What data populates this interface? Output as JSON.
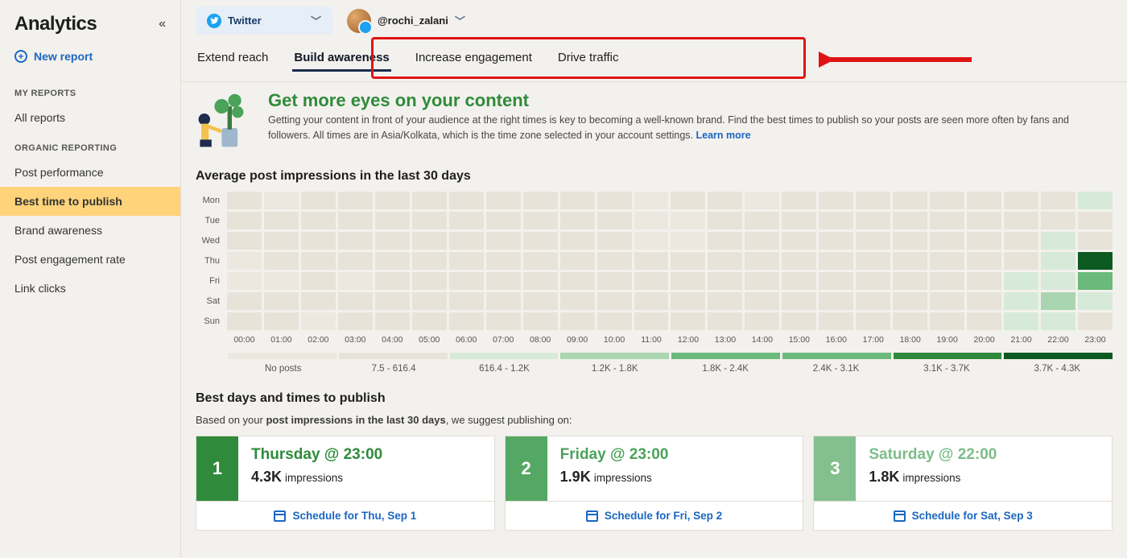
{
  "sidebar": {
    "title": "Analytics",
    "new_report": "New report",
    "sections": {
      "my_reports": {
        "label": "MY REPORTS",
        "items": [
          "All reports"
        ]
      },
      "organic": {
        "label": "ORGANIC REPORTING",
        "items": [
          "Post performance",
          "Best time to publish",
          "Brand awareness",
          "Post engagement rate",
          "Link clicks"
        ],
        "selected_index": 1
      }
    }
  },
  "header": {
    "platform": {
      "name": "Twitter"
    },
    "account": {
      "handle": "@rochi_zalani"
    }
  },
  "tabs": {
    "items": [
      "Extend reach",
      "Build awareness",
      "Increase engagement",
      "Drive traffic"
    ],
    "active_index": 1
  },
  "hero": {
    "title": "Get more eyes on your content",
    "desc": "Getting your content in front of your audience at the right times is key to becoming a well-known brand. Find the best times to publish so your posts are seen more often by fans and followers. All times are in Asia/Kolkata, which is the time zone selected in your account settings. ",
    "learn": "Learn more"
  },
  "heatmap": {
    "title": "Average post impressions in the last 30 days",
    "days": [
      "Mon",
      "Tue",
      "Wed",
      "Thu",
      "Fri",
      "Sat",
      "Sun"
    ],
    "hours": [
      "00:00",
      "01:00",
      "02:00",
      "03:00",
      "04:00",
      "05:00",
      "06:00",
      "07:00",
      "08:00",
      "09:00",
      "10:00",
      "11:00",
      "12:00",
      "13:00",
      "14:00",
      "15:00",
      "16:00",
      "17:00",
      "18:00",
      "19:00",
      "20:00",
      "21:00",
      "22:00",
      "23:00"
    ],
    "legend_segments": [
      {
        "label": "No posts",
        "intensity": 0
      },
      {
        "label": "7.5 - 616.4",
        "intensity": 1
      },
      {
        "label": "616.4 - 1.2K",
        "intensity": 2
      },
      {
        "label": "1.2K - 1.8K",
        "intensity": 3
      },
      {
        "label": "1.8K - 2.4K",
        "intensity": 4
      },
      {
        "label": "2.4K - 3.1K",
        "intensity": 4
      },
      {
        "label": "3.1K - 3.7K",
        "intensity": 5
      },
      {
        "label": "3.7K - 4.3K",
        "intensity": 6
      }
    ]
  },
  "chart_data": {
    "type": "heatmap",
    "title": "Average post impressions in the last 30 days",
    "xlabel": "Hour of day",
    "ylabel": "Day of week",
    "x": [
      "00:00",
      "01:00",
      "02:00",
      "03:00",
      "04:00",
      "05:00",
      "06:00",
      "07:00",
      "08:00",
      "09:00",
      "10:00",
      "11:00",
      "12:00",
      "13:00",
      "14:00",
      "15:00",
      "16:00",
      "17:00",
      "18:00",
      "19:00",
      "20:00",
      "21:00",
      "22:00",
      "23:00"
    ],
    "y": [
      "Mon",
      "Tue",
      "Wed",
      "Thu",
      "Fri",
      "Sat",
      "Sun"
    ],
    "values_intensity": [
      [
        1,
        0,
        1,
        1,
        1,
        1,
        1,
        1,
        1,
        1,
        1,
        0,
        1,
        1,
        0,
        1,
        1,
        1,
        1,
        1,
        1,
        1,
        1,
        2
      ],
      [
        1,
        1,
        1,
        1,
        1,
        1,
        1,
        1,
        1,
        1,
        1,
        0,
        0,
        1,
        1,
        1,
        1,
        1,
        1,
        1,
        1,
        1,
        1,
        1
      ],
      [
        1,
        1,
        1,
        1,
        1,
        1,
        1,
        1,
        1,
        1,
        1,
        0,
        0,
        1,
        1,
        1,
        1,
        1,
        1,
        1,
        1,
        1,
        2,
        1
      ],
      [
        0,
        1,
        1,
        1,
        1,
        1,
        1,
        1,
        1,
        1,
        1,
        1,
        1,
        1,
        1,
        1,
        1,
        1,
        1,
        1,
        1,
        1,
        2,
        6
      ],
      [
        0,
        0,
        1,
        0,
        1,
        1,
        1,
        1,
        1,
        1,
        1,
        1,
        1,
        1,
        1,
        1,
        1,
        1,
        1,
        1,
        1,
        2,
        2,
        4
      ],
      [
        1,
        1,
        1,
        1,
        1,
        1,
        1,
        1,
        1,
        1,
        1,
        1,
        1,
        1,
        1,
        1,
        1,
        1,
        1,
        1,
        1,
        2,
        3,
        2
      ],
      [
        1,
        1,
        0,
        1,
        1,
        1,
        1,
        1,
        1,
        1,
        1,
        1,
        1,
        1,
        1,
        1,
        1,
        1,
        1,
        1,
        1,
        2,
        2,
        1
      ]
    ],
    "intensity_scale": [
      "No posts",
      "7.5 - 616.4",
      "616.4 - 1.2K",
      "1.2K - 1.8K",
      "1.8K - 2.4K",
      "2.4K - 3.1K",
      "3.1K - 3.7K",
      "3.7K - 4.3K"
    ]
  },
  "best_times": {
    "heading": "Best days and times to publish",
    "line_pre": "Based on your ",
    "line_bold": "post impressions in the last 30 days",
    "line_post": ", we suggest publishing on:",
    "cards": [
      {
        "rank": "1",
        "slot": "Thursday @ 23:00",
        "value": "4.3K",
        "unit": "impressions",
        "cta": "Schedule for Thu, Sep 1"
      },
      {
        "rank": "2",
        "slot": "Friday @ 23:00",
        "value": "1.9K",
        "unit": "impressions",
        "cta": "Schedule for Fri, Sep 2"
      },
      {
        "rank": "3",
        "slot": "Saturday @ 22:00",
        "value": "1.8K",
        "unit": "impressions",
        "cta": "Schedule for Sat, Sep 3"
      }
    ]
  }
}
